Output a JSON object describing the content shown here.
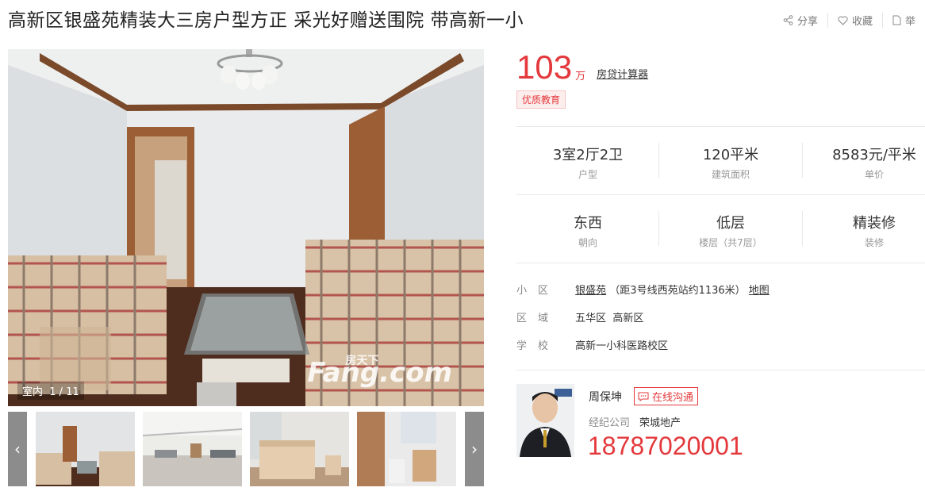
{
  "title": "高新区银盛苑精装大三房户型方正 采光好赠送围院 带高新一小",
  "actions": {
    "share": "分享",
    "favorite": "收藏",
    "report": "举"
  },
  "photo": {
    "caption_category": "室内",
    "caption_index": "1 / 11",
    "watermark_small": "房天下",
    "watermark_big": "Fang.com"
  },
  "thumbs": {
    "prev": "‹",
    "next": "›"
  },
  "price": {
    "value": "103",
    "unit": "万",
    "loan_calc": "房贷计算器",
    "tag": "优质教育"
  },
  "stats_row1": [
    {
      "value": "3室2厅2卫",
      "label": "户型"
    },
    {
      "value": "120平米",
      "label": "建筑面积"
    },
    {
      "value": "8583元/平米",
      "label": "单价"
    }
  ],
  "stats_row2": [
    {
      "value": "东西",
      "label": "朝向"
    },
    {
      "value": "低层",
      "label": "楼层（共7层）"
    },
    {
      "value": "精装修",
      "label": "装修"
    }
  ],
  "info": {
    "community_label": "小区",
    "community_name": "银盛苑",
    "community_distance": "（距3号线西苑站约1136米）",
    "map_link": "地图",
    "district_label": "区域",
    "district_1": "五华区",
    "district_2": "高新区",
    "school_label": "学校",
    "school_name": "高新一小科医路校区"
  },
  "agent": {
    "name": "周保坤",
    "chat": "在线沟通",
    "company_label": "经纪公司",
    "company": "荣城地产",
    "phone": "18787020001"
  },
  "colors": {
    "accent": "#e4393c"
  }
}
